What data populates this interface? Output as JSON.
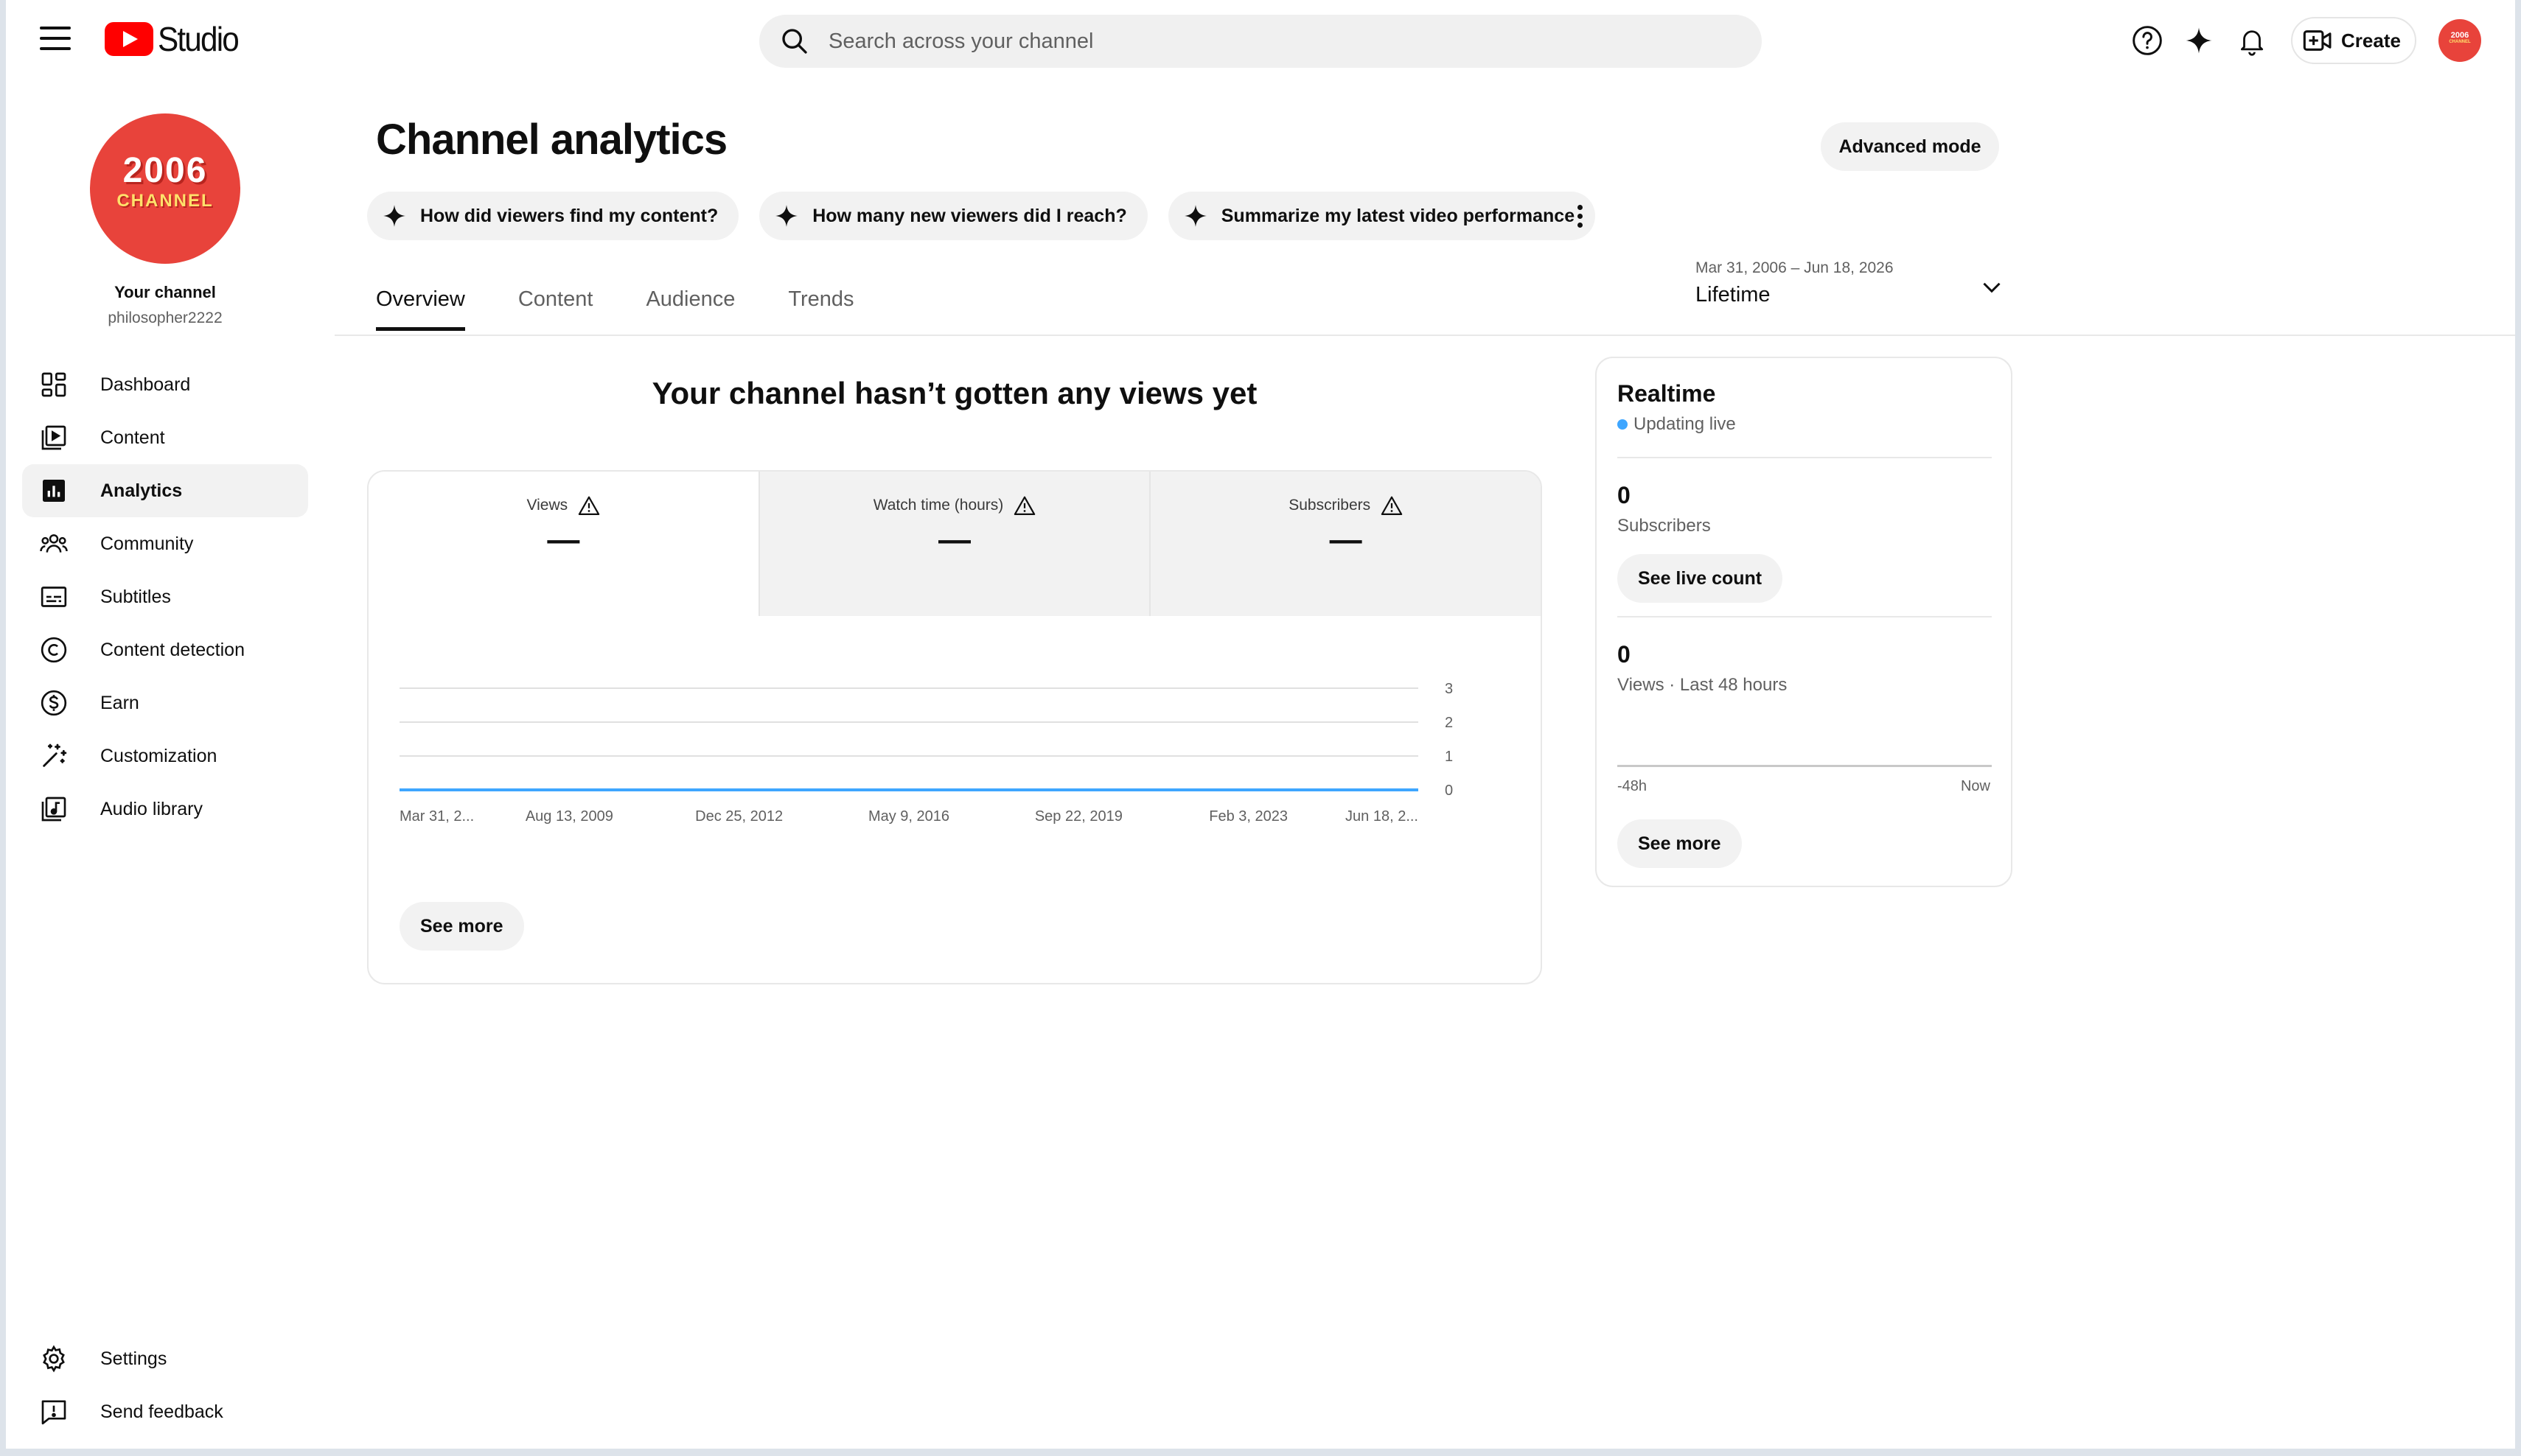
{
  "app": {
    "logo_text": "Studio",
    "brand_color": "#ff0000"
  },
  "search": {
    "placeholder": "Search across your channel"
  },
  "header": {
    "create_label": "Create",
    "avatar_text_1": "2006",
    "avatar_text_2": "CHANNEL",
    "icons": [
      "help-icon",
      "sparkle-icon",
      "notifications-icon",
      "create-video-icon"
    ]
  },
  "channel": {
    "avatar_line1": "2006",
    "avatar_line2": "CHANNEL",
    "name": "Your channel",
    "handle": "philosopher2222",
    "avatar_color": "#e8433b"
  },
  "sidebar": {
    "items": [
      {
        "label": "Dashboard",
        "icon": "dashboard-icon",
        "active": false
      },
      {
        "label": "Content",
        "icon": "content-icon",
        "active": false
      },
      {
        "label": "Analytics",
        "icon": "analytics-icon",
        "active": true
      },
      {
        "label": "Community",
        "icon": "community-icon",
        "active": false
      },
      {
        "label": "Subtitles",
        "icon": "subtitles-icon",
        "active": false
      },
      {
        "label": "Content detection",
        "icon": "copyright-icon",
        "active": false
      },
      {
        "label": "Earn",
        "icon": "dollar-icon",
        "active": false
      },
      {
        "label": "Customization",
        "icon": "magic-wand-icon",
        "active": false
      },
      {
        "label": "Audio library",
        "icon": "audio-library-icon",
        "active": false
      }
    ],
    "bottom": [
      {
        "label": "Settings",
        "icon": "gear-icon"
      },
      {
        "label": "Send feedback",
        "icon": "feedback-icon"
      }
    ]
  },
  "main": {
    "title": "Channel analytics",
    "advanced_mode_label": "Advanced mode",
    "chips": [
      "How did viewers find my content?",
      "How many new viewers did I reach?",
      "Summarize my latest video performance"
    ],
    "tabs": [
      {
        "label": "Overview",
        "active": true
      },
      {
        "label": "Content",
        "active": false
      },
      {
        "label": "Audience",
        "active": false
      },
      {
        "label": "Trends",
        "active": false
      }
    ],
    "date_range": {
      "range": "Mar 31, 2006 – Jun 18, 2026",
      "label": "Lifetime"
    },
    "empty_message": "Your channel hasn’t gotten any views yet",
    "metrics": [
      {
        "label": "Views",
        "value": "—",
        "active": true
      },
      {
        "label": "Watch time (hours)",
        "value": "—",
        "active": false
      },
      {
        "label": "Subscribers",
        "value": "—",
        "active": false
      }
    ],
    "see_more_label": "See more"
  },
  "chart_data": {
    "type": "line",
    "x": [
      "Mar 31, 2...",
      "Aug 13, 2009",
      "Dec 25, 2012",
      "May 9, 2016",
      "Sep 22, 2019",
      "Feb 3, 2023",
      "Jun 18, 2..."
    ],
    "series": [
      {
        "values": [
          0,
          0,
          0,
          0,
          0,
          0,
          0
        ]
      }
    ],
    "y_ticks": [
      "3",
      "2",
      "1",
      "0"
    ],
    "ylim": [
      0,
      3
    ],
    "grid": true,
    "line_color": "#3ea6ff"
  },
  "realtime": {
    "title": "Realtime",
    "status": "Updating live",
    "subscribers_value": "0",
    "subscribers_label": "Subscribers",
    "live_count_label": "See live count",
    "views_value": "0",
    "views_label": "Views · Last 48 hours",
    "axis_start": "-48h",
    "axis_end": "Now",
    "see_more_label": "See more",
    "live_dot_color": "#3ea6ff"
  }
}
